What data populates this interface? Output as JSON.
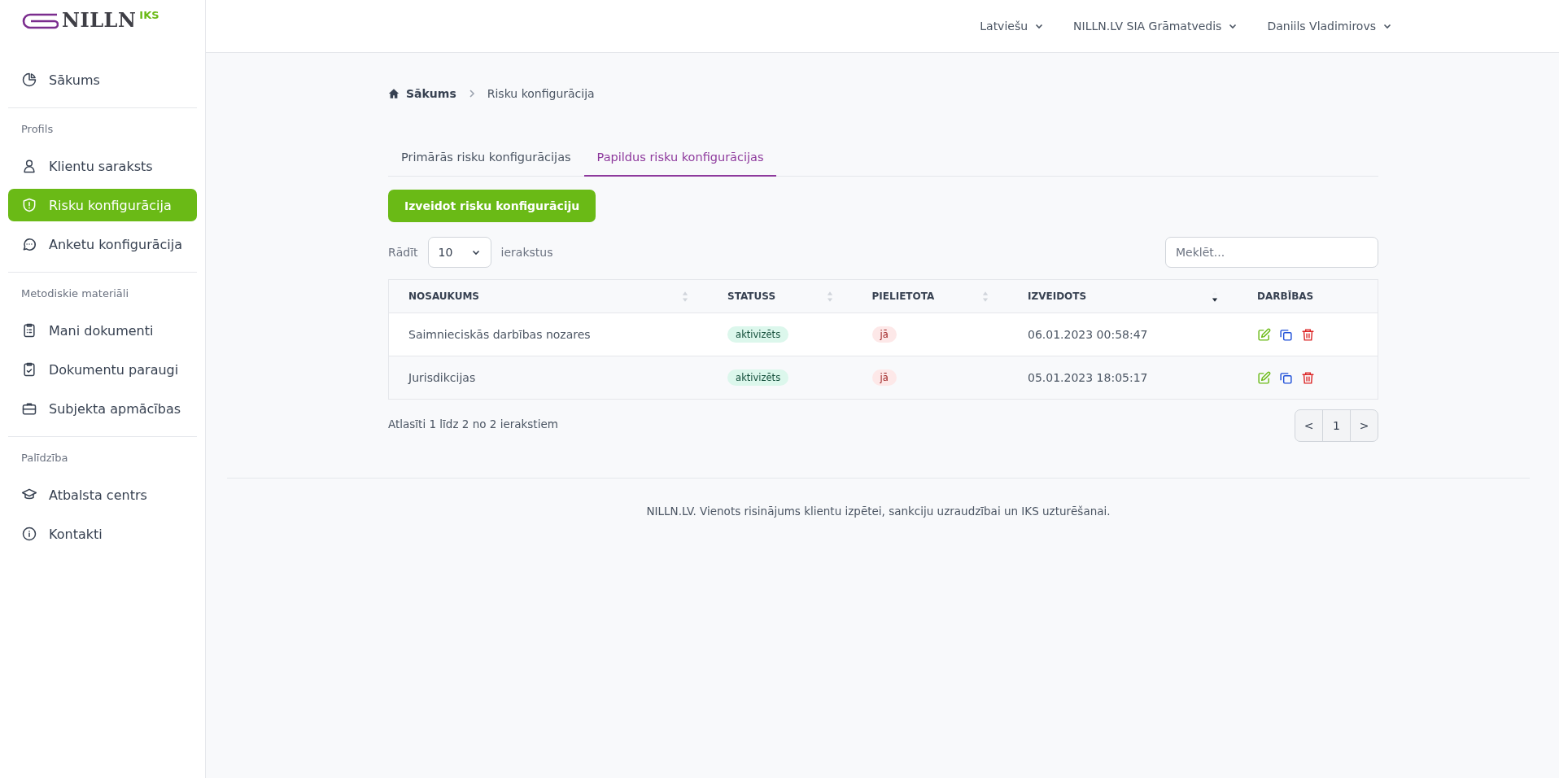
{
  "logo": {
    "name": "NILLN",
    "suffix": "IKS"
  },
  "sidebar": {
    "sections": [
      {
        "items": [
          {
            "label": "Sākums",
            "selected": false
          }
        ]
      },
      {
        "heading": "Profils",
        "items": [
          {
            "label": "Klientu saraksts",
            "selected": false
          },
          {
            "label": "Risku konfigurācija",
            "selected": true
          },
          {
            "label": "Anketu konfigurācija",
            "selected": false
          }
        ]
      },
      {
        "heading": "Metodiskie materiāli",
        "items": [
          {
            "label": "Mani dokumenti",
            "selected": false
          },
          {
            "label": "Dokumentu paraugi",
            "selected": false
          },
          {
            "label": "Subjekta apmācības",
            "selected": false
          }
        ]
      },
      {
        "heading": "Palīdzība",
        "items": [
          {
            "label": "Atbalsta centrs",
            "selected": false
          },
          {
            "label": "Kontakti",
            "selected": false
          }
        ]
      }
    ]
  },
  "header": {
    "menus": [
      "Latviešu",
      "NILLN.LV SIA Grāmatvedis",
      "Daniils Vladimirovs"
    ]
  },
  "breadcrumb": [
    "Sākums",
    "Risku konfigurācija"
  ],
  "tabs": [
    {
      "label": "Primārās risku konfigurācijas",
      "selected": false
    },
    {
      "label": "Papildus risku konfigurācijas",
      "selected": true
    }
  ],
  "create_button": "Izveidot risku konfigurāciju",
  "page_size": {
    "label": "Rādīt",
    "value": "10",
    "suffix": "ierakstus"
  },
  "search": {
    "placeholder": "Meklēt..."
  },
  "table": {
    "columns": [
      {
        "label": "NOSAUKUMS",
        "sorted": false
      },
      {
        "label": "STATUSS",
        "sorted": false
      },
      {
        "label": "PIELIETOTA",
        "sorted": false
      },
      {
        "label": "IZVEIDOTS",
        "sorted": true
      },
      {
        "label": "DARBĪBAS"
      }
    ],
    "rows": [
      {
        "name": "Saimnieciskās darbības nozares",
        "status": "aktivizēts",
        "used": "jā",
        "created": "06.01.2023 00:58:47"
      },
      {
        "name": "Jurisdikcijas",
        "status": "aktivizēts",
        "used": "jā",
        "created": "05.01.2023 18:05:17"
      }
    ]
  },
  "table_info": "Atlasīti 1 līdz 2 no 2 ierakstiem",
  "pagination": {
    "prev": "<",
    "pages": [
      "1"
    ],
    "next": ">"
  },
  "footer": "NILLN.LV. Vienots risinājums klientu izpētei, sankciju uzraudzībai un IKS uzturēšanai."
}
